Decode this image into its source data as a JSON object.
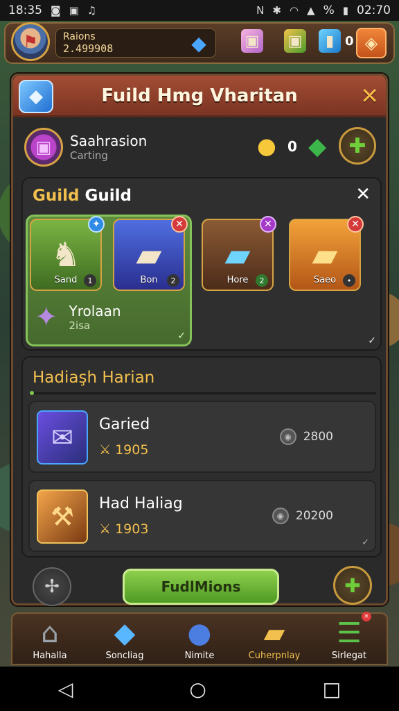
{
  "status": {
    "time": "18:35",
    "right_time": "02:70",
    "battery_pct": "%"
  },
  "topbar": {
    "player_name": "Raions",
    "player_score": "2.499908",
    "blue_count": "0"
  },
  "panel": {
    "title": "Fuild Hmg Vharitan",
    "guild_name": "Saahrasion",
    "guild_sub": "Carting",
    "coin_count": "0"
  },
  "guild_section": {
    "title_gold": "Guild",
    "title_white": "Guild",
    "cards": [
      {
        "label": "Sand"
      },
      {
        "label": "Bon"
      },
      {
        "label": "Hore"
      },
      {
        "label": "Saeo"
      }
    ],
    "unit_name": "Yrolaan",
    "unit_sub": "2isa"
  },
  "harian": {
    "title": "Hadiaşh Harian",
    "quests": [
      {
        "name": "Garied",
        "value": "1905",
        "reward": "2800"
      },
      {
        "name": "Had Haliag",
        "value": "1903",
        "reward": "20200"
      }
    ]
  },
  "actions": {
    "main_button": "FudlMions"
  },
  "tabs": [
    {
      "label": "Hahalla"
    },
    {
      "label": "Soncliag"
    },
    {
      "label": "Nimite"
    },
    {
      "label": "Cuherpnlay"
    },
    {
      "label": "Sirlegat"
    }
  ],
  "colors": {
    "header_red": "#a34d34",
    "accent_gold": "#f2c04e",
    "selected_green": "#5f8c3c",
    "button_green": "#8fd04e"
  }
}
